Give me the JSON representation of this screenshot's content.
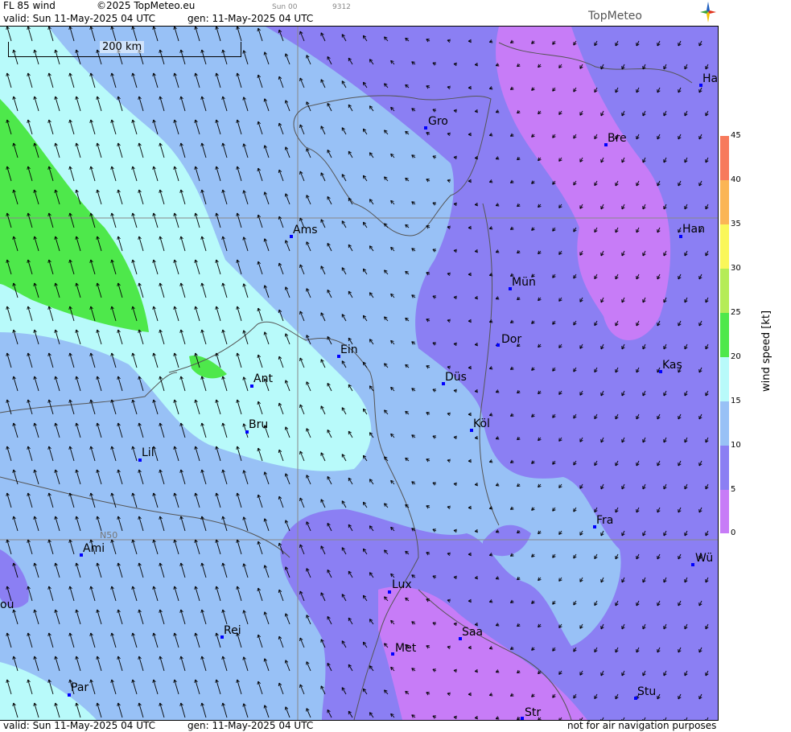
{
  "header": {
    "product": "FL 85 wind",
    "copyright": "©2025 TopMeteo.eu",
    "valid": "valid:  Sun  11-May-2025  04 UTC",
    "generated": "gen: 11-May-2025 04 UTC",
    "run": "Sun 00",
    "code": "9312",
    "logo": "TopMeteo"
  },
  "footer": {
    "valid": "valid:  Sun  11-May-2025  04 UTC",
    "generated": "gen: 11-May-2025 04 UTC",
    "disclaimer": "not for air navigation purposes"
  },
  "map": {
    "scale_label": "200 km",
    "graticule_label": "N50",
    "cities": [
      "Ha",
      "Gro",
      "Bre",
      "Ams",
      "Han",
      "Mün",
      "Ein",
      "Dor",
      "Kas",
      "Ant",
      "Düs",
      "Bru",
      "Köl",
      "Lil",
      "Fra",
      "Ami",
      "Wü",
      "Lux",
      "ou",
      "Saa",
      "Rei",
      "Met",
      "Par",
      "Stu",
      "Str"
    ]
  },
  "legend": {
    "title": "wind  speed  [kt]",
    "ticks": [
      "45",
      "40",
      "35",
      "30",
      "25",
      "20",
      "15",
      "10",
      "5",
      "0"
    ],
    "colors": {
      "0-5": "#c77cf7",
      "5-10": "#8b7ff3",
      "10-15": "#98c1f6",
      "15-20": "#b8fafa",
      "20-25": "#4ee84b",
      "25-30": "#b5ec57",
      "30-35": "#faf75a",
      "35-40": "#fbb555",
      "40-45": "#f77a5c"
    }
  }
}
